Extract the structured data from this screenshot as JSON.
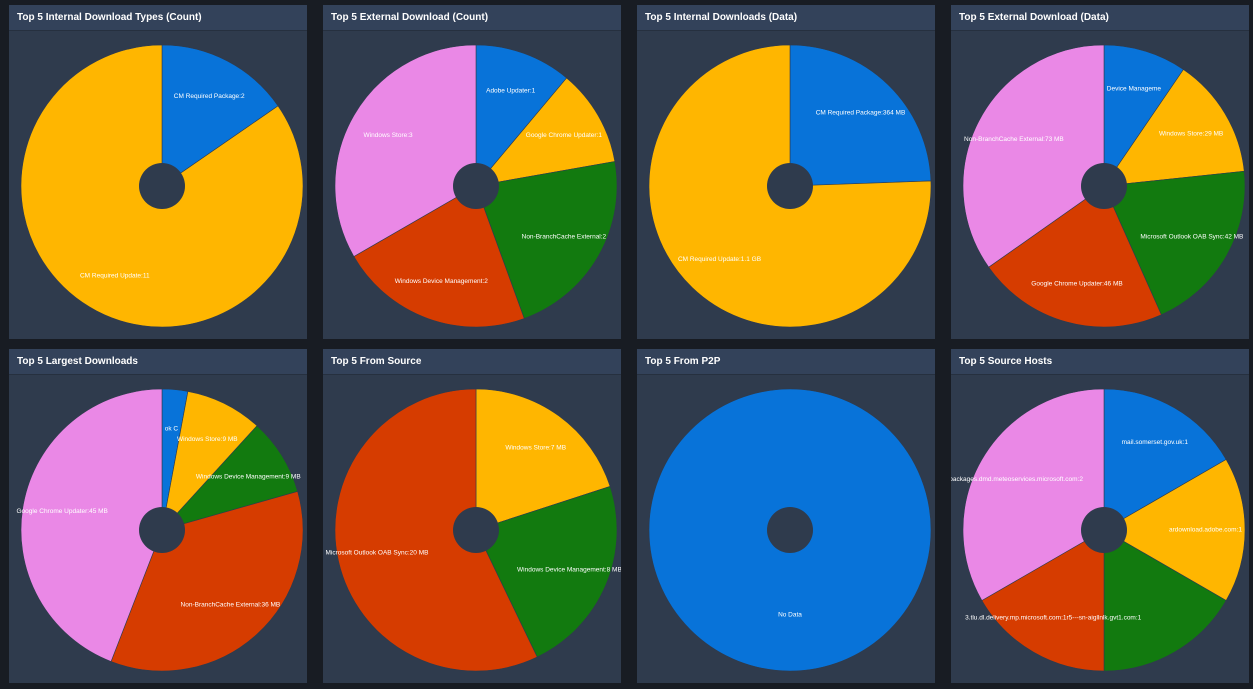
{
  "chart_data": [
    {
      "type": "pie",
      "title": "Top 5 Internal Download Types (Count)",
      "slices": [
        {
          "label": "CM Required Package:2",
          "value": 2,
          "color": "#0873d9"
        },
        {
          "label": "CM Required Update:11",
          "value": 11,
          "color": "#ffb600"
        }
      ]
    },
    {
      "type": "pie",
      "title": "Top 5 External Download (Count)",
      "slices": [
        {
          "label": "Adobe Updater:1",
          "value": 1,
          "color": "#0873d9"
        },
        {
          "label": "Google Chrome Updater:1",
          "value": 1,
          "color": "#ffb600"
        },
        {
          "label": "Non-BranchCache External:2",
          "value": 2,
          "color": "#127a0f"
        },
        {
          "label": "Windows Device Management:2",
          "value": 2,
          "color": "#d63c00"
        },
        {
          "label": "Windows Store:3",
          "value": 3,
          "color": "#ea88e6"
        }
      ]
    },
    {
      "type": "pie",
      "title": "Top 5 Internal Downloads (Data)",
      "slices": [
        {
          "label": "CM Required Package:364 MB",
          "value": 364,
          "color": "#0873d9"
        },
        {
          "label": "CM Required Update:1.1 GB",
          "value": 1126,
          "color": "#ffb600"
        }
      ]
    },
    {
      "type": "pie",
      "title": "Top 5 External Download (Data)",
      "slices": [
        {
          "label": "Device Manageme",
          "value": 20,
          "color": "#0873d9"
        },
        {
          "label": "Windows Store:29 MB",
          "value": 29,
          "color": "#ffb600"
        },
        {
          "label": "Microsoft Outlook OAB Sync:42 MB",
          "value": 42,
          "color": "#127a0f"
        },
        {
          "label": "Google Chrome Updater:46 MB",
          "value": 46,
          "color": "#d63c00"
        },
        {
          "label": "Non-BranchCache External:73 MB",
          "value": 73,
          "color": "#ea88e6"
        }
      ]
    },
    {
      "type": "pie",
      "title": "Top 5 Largest Downloads",
      "slices": [
        {
          "label": "ok C",
          "value": 3,
          "color": "#0873d9"
        },
        {
          "label": "Windows Store:9 MB",
          "value": 9,
          "color": "#ffb600"
        },
        {
          "label": "Windows Device Management:9 MB",
          "value": 9,
          "color": "#127a0f"
        },
        {
          "label": "Non-BranchCache External:36 MB",
          "value": 36,
          "color": "#d63c00"
        },
        {
          "label": "Google Chrome Updater:45 MB",
          "value": 45,
          "color": "#ea88e6"
        }
      ]
    },
    {
      "type": "pie",
      "title": "Top 5 From Source",
      "slices": [
        {
          "label": "Windows Store:7 MB",
          "value": 7,
          "color": "#ffb600"
        },
        {
          "label": "Windows Device Management:8 MB",
          "value": 8,
          "color": "#127a0f"
        },
        {
          "label": "Microsoft Outlook OAB Sync:20 MB",
          "value": 20,
          "color": "#d63c00"
        }
      ]
    },
    {
      "type": "pie",
      "title": "Top 5 From P2P",
      "slices": [
        {
          "label": "No Data",
          "value": 1,
          "color": "#0873d9"
        }
      ]
    },
    {
      "type": "pie",
      "title": "Top 5 Source Hosts",
      "slices": [
        {
          "label": "mail.somerset.gov.uk:1",
          "value": 1,
          "color": "#0873d9"
        },
        {
          "label": "ardownload.adobe.com:1",
          "value": 1,
          "color": "#ffb600"
        },
        {
          "label": "",
          "value": 1,
          "color": "#127a0f"
        },
        {
          "label": "3.tlu.dl.delivery.mp.microsoft.com:1r5---sn-aigllnlk.gvt1.com:1",
          "value": 1,
          "color": "#d63c00"
        },
        {
          "label": "packages.dmd.meteoservices.microsoft.com:2",
          "value": 2,
          "color": "#ea88e6"
        }
      ]
    }
  ]
}
